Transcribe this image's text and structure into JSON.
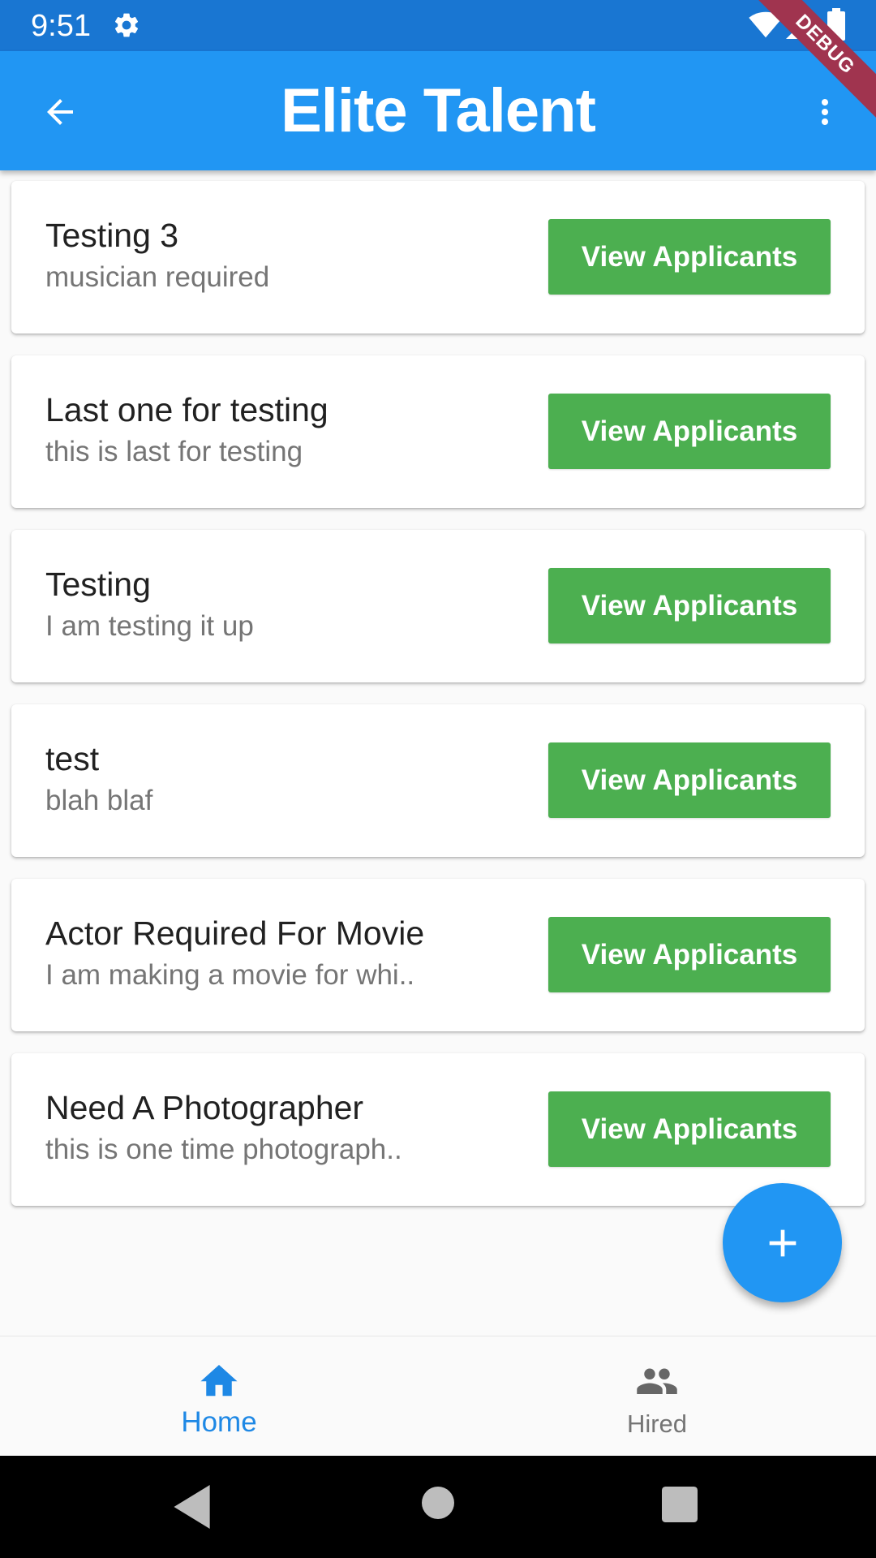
{
  "status_bar": {
    "time": "9:51"
  },
  "app_bar": {
    "title": "Elite Talent",
    "debug_label": "DEBUG"
  },
  "jobs": [
    {
      "title": "Testing 3",
      "subtitle": "musician required",
      "button": "View Applicants"
    },
    {
      "title": "Last one for testing",
      "subtitle": "this is last for testing",
      "button": "View Applicants"
    },
    {
      "title": "Testing",
      "subtitle": "I am testing it up",
      "button": "View Applicants"
    },
    {
      "title": "test",
      "subtitle": "blah blaf",
      "button": "View Applicants"
    },
    {
      "title": "Actor Required For Movie",
      "subtitle": "I am making a movie for whi..",
      "button": "View Applicants"
    },
    {
      "title": "Need A Photographer",
      "subtitle": "this is one time photograph..",
      "button": "View Applicants"
    }
  ],
  "bottom_nav": {
    "items": [
      {
        "label": "Home",
        "icon": "home-icon",
        "active": true
      },
      {
        "label": "Hired",
        "icon": "people-icon",
        "active": false
      }
    ]
  },
  "colors": {
    "status_bar": "#1976d2",
    "app_bar": "#2196f3",
    "button": "#4caf50",
    "fab": "#2196f3",
    "active_nav": "#1e88e5",
    "inactive_nav": "#757575",
    "debug_ribbon": "#a0344f"
  }
}
